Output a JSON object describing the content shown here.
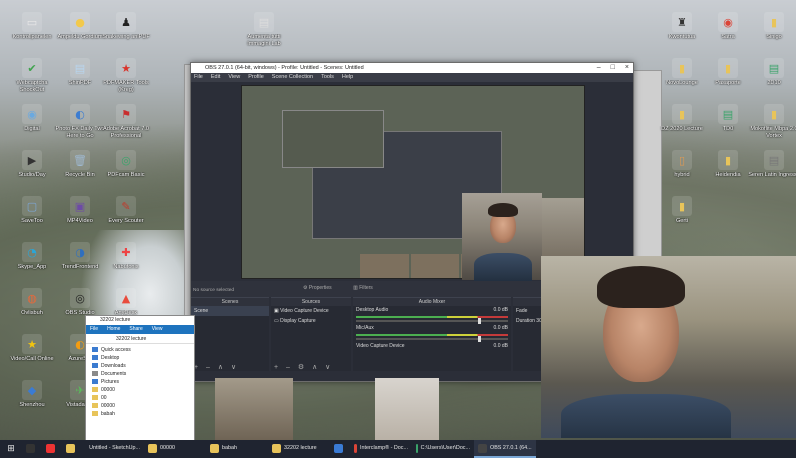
{
  "desktop": {
    "icons_left": [
      {
        "label": "Kontrollpanelen",
        "glyph": "▭",
        "color": "#e8e8e8"
      },
      {
        "label": "Ampeldu Gordium",
        "glyph": "●",
        "color": "#f2c94c"
      },
      {
        "label": "Snakewing aniPDF",
        "glyph": "♟",
        "color": "#222"
      },
      {
        "label": "Webcaptcha ShockOut",
        "glyph": "✔",
        "color": "#3fa34d"
      },
      {
        "label": "ShinPDF",
        "glyph": "▤",
        "color": "#b8d6f0"
      },
      {
        "label": "PDFMAKER Tools (Kreg)",
        "glyph": "★",
        "color": "#d9342b"
      },
      {
        "label": "Digital",
        "glyph": "◉",
        "color": "#6aa9e0"
      },
      {
        "label": "Photo FX Daily Two Here to Go",
        "glyph": "◐",
        "color": "#3d7dd1"
      },
      {
        "label": "Adobe Acrobat 7.0 Professional",
        "glyph": "⚑",
        "color": "#c92d2d"
      },
      {
        "label": "Studio/Day",
        "glyph": "▶",
        "color": "#333"
      },
      {
        "label": "Recycle Bin",
        "glyph": "🗑",
        "color": "#9fb8cf"
      },
      {
        "label": "PDFcam Basic",
        "glyph": "◎",
        "color": "#3aa36a"
      },
      {
        "label": "SaveToo",
        "glyph": "▢",
        "color": "#7da6d4"
      },
      {
        "label": "MP4Video",
        "glyph": "▣",
        "color": "#6d4aa6"
      },
      {
        "label": "Every Scouter",
        "glyph": "✎",
        "color": "#c0392b"
      },
      {
        "label": "Skype_App",
        "glyph": "◔",
        "color": "#2aa6d8"
      },
      {
        "label": "TrendFrontend",
        "glyph": "◑",
        "color": "#2f6fbf"
      },
      {
        "label": "Nabufonis",
        "glyph": "✚",
        "color": "#e44"
      },
      {
        "label": "Ovlisbuh",
        "glyph": "◍",
        "color": "#e8693a"
      },
      {
        "label": "OBS Studio",
        "glyph": "◎",
        "color": "#222"
      },
      {
        "label": "AnyDesk",
        "glyph": "▲",
        "color": "#e84c3d"
      },
      {
        "label": "Video/Call Online",
        "glyph": "★",
        "color": "#f1c40f"
      },
      {
        "label": "AzureSet",
        "glyph": "◐",
        "color": "#f39c12"
      },
      {
        "label": "MirrorShop",
        "glyph": "✪",
        "color": "#27ae60"
      },
      {
        "label": "Shenzhou",
        "glyph": "◆",
        "color": "#3a7bd5"
      },
      {
        "label": "Vistadasde",
        "glyph": "✈",
        "color": "#5cb85c"
      },
      {
        "label": "PDF Opus Wood",
        "glyph": "▦",
        "color": "#c0392b"
      }
    ],
    "icons_top_center": [
      {
        "label": "Aumenta tutti Immagini Lab",
        "glyph": "▤",
        "color": "#ddd"
      }
    ],
    "icons_right": [
      {
        "label": "Kwontutua",
        "glyph": "♜",
        "color": "#333"
      },
      {
        "label": "Satra",
        "glyph": "◉",
        "color": "#db4437"
      },
      {
        "label": "Sinigo",
        "glyph": "▮",
        "color": "#e8c45a"
      },
      {
        "label": "NovoLounge",
        "glyph": "▮",
        "color": "#e8c45a"
      },
      {
        "label": "Pasaporte",
        "glyph": "▮",
        "color": "#e8c45a"
      },
      {
        "label": "2D10",
        "glyph": "▤",
        "color": "#3aa36a"
      },
      {
        "label": "DZ 2020 Lecture",
        "glyph": "▮",
        "color": "#e8c45a"
      },
      {
        "label": "TD0",
        "glyph": "▤",
        "color": "#3aa36a"
      },
      {
        "label": "Mokoflite Mbpa 2.0 Vortex",
        "glyph": "▮",
        "color": "#e8c45a"
      },
      {
        "label": "hybrid",
        "glyph": "▯",
        "color": "#d95"
      },
      {
        "label": "Heidendia",
        "glyph": "▮",
        "color": "#e8c45a"
      },
      {
        "label": "Seren Latin Ingresso",
        "glyph": "▤",
        "color": "#777"
      },
      {
        "label": "Gerti",
        "glyph": "▮",
        "color": "#e8c45a"
      }
    ]
  },
  "obs": {
    "title": "OBS 27.0.1 (64-bit, windows) - Profile: Untitled - Scenes: Untitled",
    "menu": [
      "File",
      "Edit",
      "View",
      "Profile",
      "Scene Collection",
      "Tools",
      "Help"
    ],
    "no_source": "No source selected",
    "properties_label": "Properties",
    "filters_label": "Filters",
    "docks": {
      "scenes": {
        "title": "Scenes",
        "items": [
          "Scene"
        ]
      },
      "sources": {
        "title": "Sources",
        "items": [
          "Video Capture Device",
          "Display Capture"
        ]
      },
      "mixer": {
        "title": "Audio Mixer",
        "channels": [
          {
            "name": "Desktop Audio",
            "db": "0.0 dB"
          },
          {
            "name": "Mic/Aux",
            "db": "0.0 dB"
          },
          {
            "name": "Video Capture Device",
            "db": "0.0 dB"
          }
        ]
      },
      "transitions": {
        "title": "Scene Transi...",
        "type": "Fade",
        "duration_label": "Duration",
        "duration": "300 ms"
      }
    },
    "status": "LIVE: 00:00:00   REC: 00:"
  },
  "explorer": {
    "title": "32202 lecture",
    "tabs": [
      "File",
      "Home",
      "Share",
      "View"
    ],
    "address": "32202 lecture",
    "nav": [
      {
        "label": "Quick access",
        "color": "#3b7bd0"
      },
      {
        "label": "Desktop",
        "color": "#3b7bd0"
      },
      {
        "label": "Downloads",
        "color": "#3b7bd0"
      },
      {
        "label": "Documents",
        "color": "#8a8a8a"
      },
      {
        "label": "Pictures",
        "color": "#3b7bd0"
      },
      {
        "label": "00000",
        "color": "#e8c45a"
      },
      {
        "label": "00",
        "color": "#e8c45a"
      },
      {
        "label": "00000",
        "color": "#e8c45a"
      },
      {
        "label": "babah",
        "color": "#e8c45a"
      }
    ]
  },
  "taskbar": {
    "items": [
      {
        "label": "",
        "color": "#333"
      },
      {
        "label": "",
        "color": "#e33"
      },
      {
        "label": "",
        "color": "#e8c45a"
      },
      {
        "label": "Untitled - SketchUp...",
        "color": "#d9542b"
      },
      {
        "label": "00000",
        "color": "#e8c45a"
      },
      {
        "label": "babah",
        "color": "#e8c45a"
      },
      {
        "label": "32202 lecture",
        "color": "#e8c45a"
      },
      {
        "label": "",
        "color": "#3a7bd5"
      },
      {
        "label": "Interclamp® - Doc...",
        "color": "#db4437"
      },
      {
        "label": "C:\\Users\\User\\Doc...",
        "color": "#3aa36a"
      },
      {
        "label": "OBS 27.0.1 (64...",
        "color": "#444"
      }
    ]
  }
}
